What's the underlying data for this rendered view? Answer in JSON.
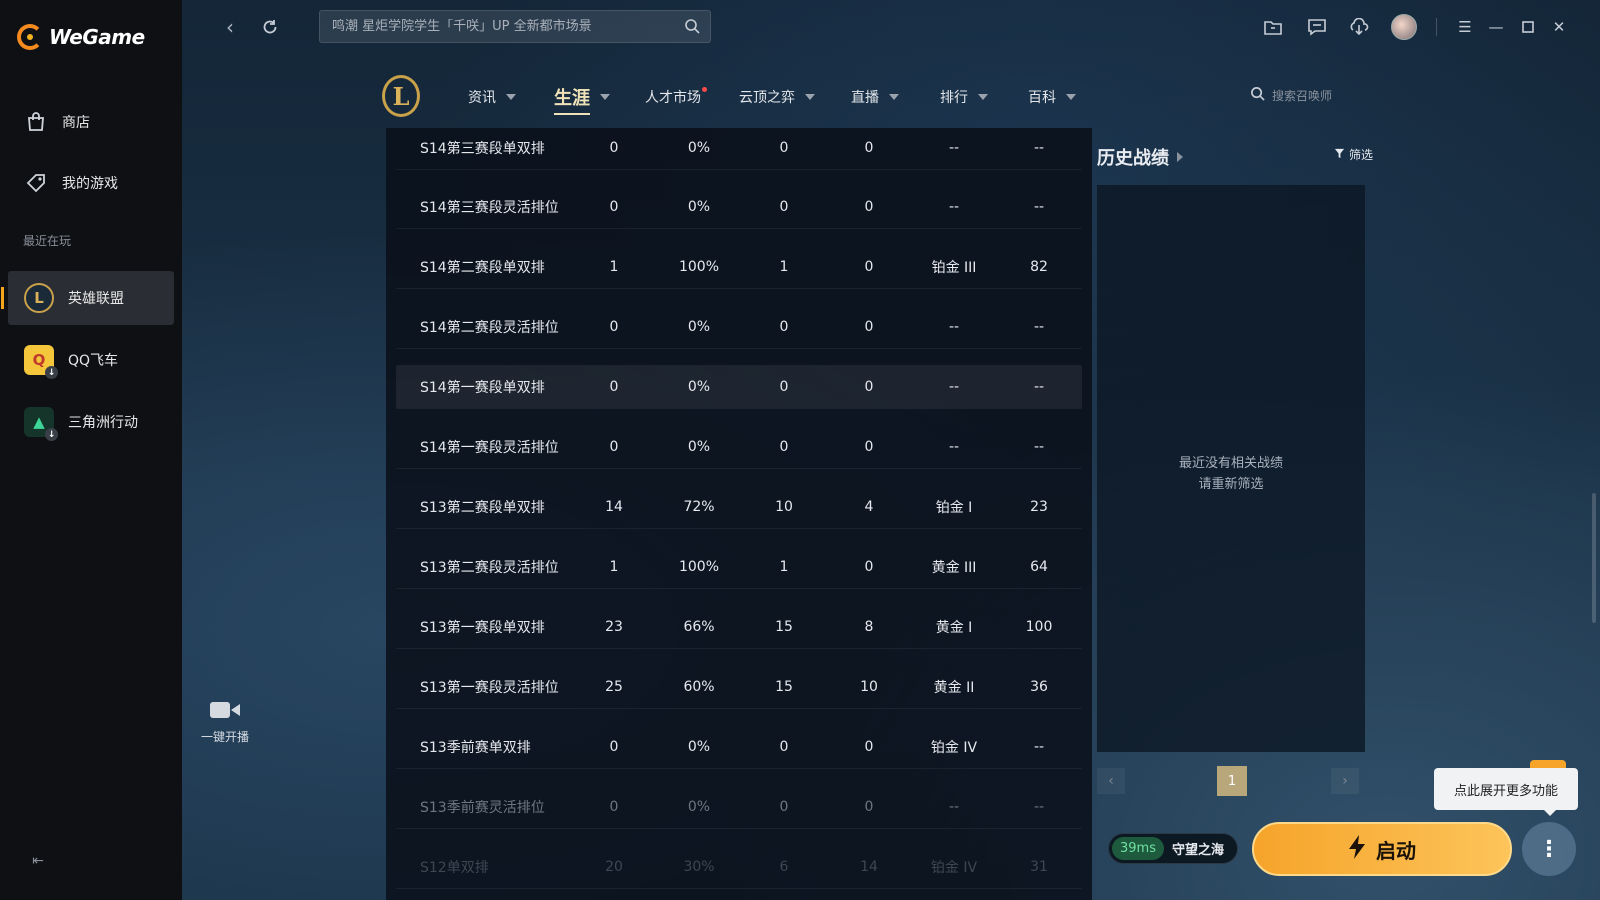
{
  "app": {
    "name": "WeGame"
  },
  "sidebar": {
    "items": [
      {
        "label": "商店"
      },
      {
        "label": "我的游戏"
      }
    ],
    "recent_label": "最近在玩",
    "games": [
      {
        "label": "英雄联盟"
      },
      {
        "label": "QQ飞车"
      },
      {
        "label": "三角洲行动"
      }
    ]
  },
  "search": {
    "placeholder": "鸣潮 星炬学院学生「千咲」UP 全新都市场景"
  },
  "game_nav": {
    "tabs": [
      {
        "label": "资讯"
      },
      {
        "label": "生涯"
      },
      {
        "label": "人才市场"
      },
      {
        "label": "云顶之弈"
      },
      {
        "label": "直播"
      },
      {
        "label": "排行"
      },
      {
        "label": "百科"
      }
    ],
    "summoner_search_placeholder": "搜索召唤师"
  },
  "table": {
    "rows": [
      [
        "S14第三赛段单双排",
        "0",
        "0%",
        "0",
        "0",
        "--",
        "--"
      ],
      [
        "S14第三赛段灵活排位",
        "0",
        "0%",
        "0",
        "0",
        "--",
        "--"
      ],
      [
        "S14第二赛段单双排",
        "1",
        "100%",
        "1",
        "0",
        "铂金 III",
        "82"
      ],
      [
        "S14第二赛段灵活排位",
        "0",
        "0%",
        "0",
        "0",
        "--",
        "--"
      ],
      [
        "S14第一赛段单双排",
        "0",
        "0%",
        "0",
        "0",
        "--",
        "--"
      ],
      [
        "S14第一赛段灵活排位",
        "0",
        "0%",
        "0",
        "0",
        "--",
        "--"
      ],
      [
        "S13第二赛段单双排",
        "14",
        "72%",
        "10",
        "4",
        "铂金 I",
        "23"
      ],
      [
        "S13第二赛段灵活排位",
        "1",
        "100%",
        "1",
        "0",
        "黄金 III",
        "64"
      ],
      [
        "S13第一赛段单双排",
        "23",
        "66%",
        "15",
        "8",
        "黄金 I",
        "100"
      ],
      [
        "S13第一赛段灵活排位",
        "25",
        "60%",
        "15",
        "10",
        "黄金 II",
        "36"
      ],
      [
        "S13季前赛单双排",
        "0",
        "0%",
        "0",
        "0",
        "铂金 IV",
        "--"
      ],
      [
        "S13季前赛灵活排位",
        "0",
        "0%",
        "0",
        "0",
        "--",
        "--"
      ],
      [
        "S12单双排",
        "20",
        "30%",
        "6",
        "14",
        "铂金 IV",
        "31"
      ]
    ]
  },
  "history": {
    "title": "历史战绩",
    "filter_label": "筛选",
    "empty_line1": "最近没有相关战绩",
    "empty_line2": "请重新筛选",
    "page": "1"
  },
  "stream": {
    "label": "一键开播"
  },
  "launch": {
    "ping": "39ms",
    "server": "守望之海",
    "button_label": "启动",
    "tooltip": "点此展开更多功能"
  }
}
